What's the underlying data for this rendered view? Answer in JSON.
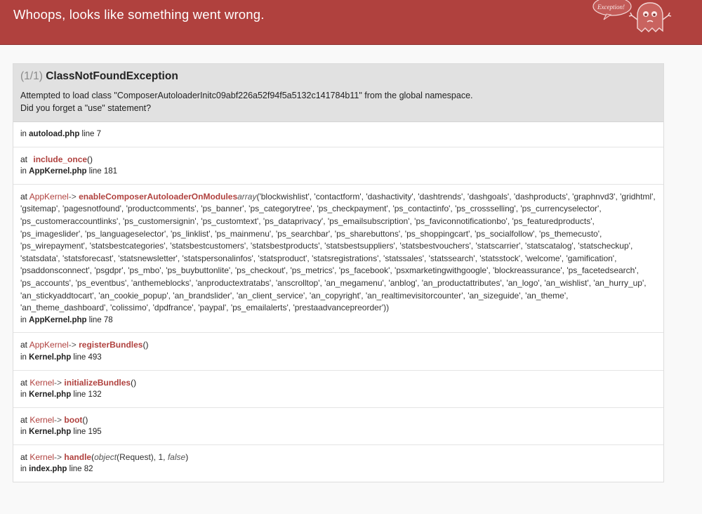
{
  "header": {
    "title": "Whoops, looks like something went wrong.",
    "badge": "Exception!"
  },
  "exception": {
    "count": "(1/1)",
    "class": "ClassNotFoundException",
    "message_line1": "Attempted to load class \"ComposerAutoloaderInitc09abf226a52f94f5a5132c141784b11\" from the global namespace.",
    "message_line2": "Did you forget a \"use\" statement?"
  },
  "trace": [
    {
      "file": "autoload.php",
      "line": "line 7"
    },
    {
      "function": "include_once",
      "args": "()",
      "file": "AppKernel.php",
      "line": "line 181"
    },
    {
      "class": "AppKernel",
      "arrow": "->",
      "function": "enableComposerAutoloaderOnModules",
      "arg_type": "array",
      "args": "('blockwishlist', 'contactform', 'dashactivity', 'dashtrends', 'dashgoals', 'dashproducts', 'graphnvd3', 'gridhtml', 'gsitemap', 'pagesnotfound', 'productcomments', 'ps_banner', 'ps_categorytree', 'ps_checkpayment', 'ps_contactinfo', 'ps_crossselling', 'ps_currencyselector', 'ps_customeraccountlinks', 'ps_customersignin', 'ps_customtext', 'ps_dataprivacy', 'ps_emailsubscription', 'ps_faviconnotificationbo', 'ps_featuredproducts', 'ps_imageslider', 'ps_languageselector', 'ps_linklist', 'ps_mainmenu', 'ps_searchbar', 'ps_sharebuttons', 'ps_shoppingcart', 'ps_socialfollow', 'ps_themecusto', 'ps_wirepayment', 'statsbestcategories', 'statsbestcustomers', 'statsbestproducts', 'statsbestsuppliers', 'statsbestvouchers', 'statscarrier', 'statscatalog', 'statscheckup', 'statsdata', 'statsforecast', 'statsnewsletter', 'statspersonalinfos', 'statsproduct', 'statsregistrations', 'statssales', 'statssearch', 'statsstock', 'welcome', 'gamification', 'psaddonsconnect', 'psgdpr', 'ps_mbo', 'ps_buybuttonlite', 'ps_checkout', 'ps_metrics', 'ps_facebook', 'psxmarketingwithgoogle', 'blockreassurance', 'ps_facetedsearch', 'ps_accounts', 'ps_eventbus', 'anthemeblocks', 'anproductextratabs', 'anscrolltop', 'an_megamenu', 'anblog', 'an_productattributes', 'an_logo', 'an_wishlist', 'an_hurry_up', 'an_stickyaddtocart', 'an_cookie_popup', 'an_brandslider', 'an_client_service', 'an_copyright', 'an_realtimevisitorcounter', 'an_sizeguide', 'an_theme', 'an_theme_dashboard', 'colissimo', 'dpdfrance', 'paypal', 'ps_emailalerts', 'prestaadvancepreorder'))",
      "file": "AppKernel.php",
      "line": "line 78"
    },
    {
      "class": "AppKernel",
      "arrow": "->",
      "function": "registerBundles",
      "args": "()",
      "file": "Kernel.php",
      "line": "line 493"
    },
    {
      "class": "Kernel",
      "arrow": "->",
      "function": "initializeBundles",
      "args": "()",
      "file": "Kernel.php",
      "line": "line 132"
    },
    {
      "class": "Kernel",
      "arrow": "->",
      "function": "boot",
      "args": "()",
      "file": "Kernel.php",
      "line": "line 195"
    },
    {
      "class": "Kernel",
      "arrow": "->",
      "function": "handle",
      "arg_type": "object",
      "args": "(Request), 1,",
      "arg_bool": "false",
      "args_end": ")",
      "file": "index.php",
      "line": "line 82"
    }
  ],
  "labels": {
    "at": "at",
    "in": "in"
  },
  "colors": {
    "header_bg": "#b0413e",
    "accent": "#b0413e",
    "exception_bg": "#e1e1e1"
  }
}
